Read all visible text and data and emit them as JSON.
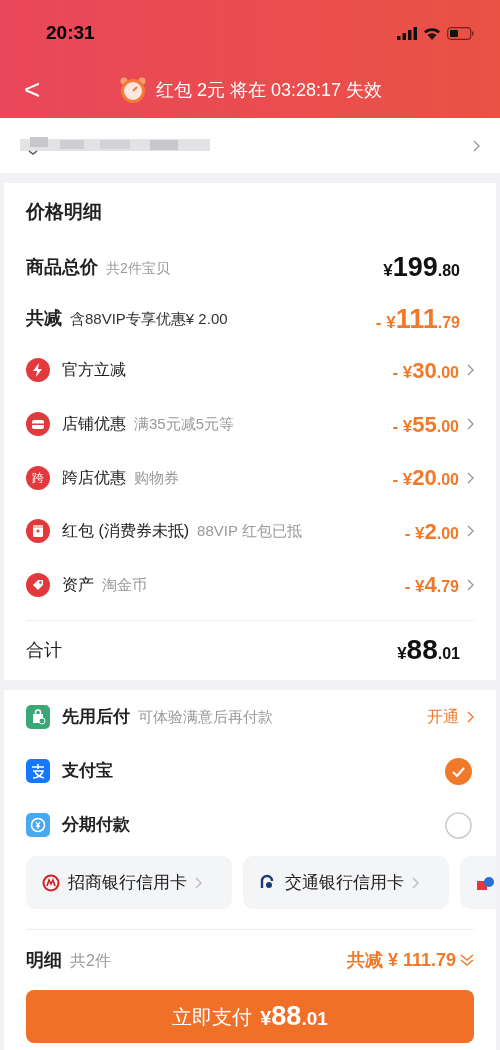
{
  "status_bar": {
    "time": "20:31"
  },
  "header": {
    "back": "<",
    "parts": [
      "红包",
      "2元",
      "将在",
      "03:28:17",
      "失效"
    ]
  },
  "price_detail": {
    "title": "价格明细",
    "total": {
      "label": "商品总价",
      "note": "共2件宝贝",
      "amount": {
        "prefix": "¥",
        "main": "199",
        "fraction": ".80"
      }
    },
    "reduction": {
      "label": "共减",
      "note": "含88VIP专享优惠¥ 2.00",
      "amount": {
        "prefix": "- ¥",
        "main": "111",
        "fraction": ".79"
      }
    },
    "discounts": [
      {
        "label": "官方立减",
        "amount": {
          "prefix": "- ¥",
          "main": "30",
          "fraction": ".00"
        }
      },
      {
        "label": "店铺优惠",
        "note": "满35元减5元等",
        "amount": {
          "prefix": "- ¥",
          "main": "55",
          "fraction": ".00"
        }
      },
      {
        "label": "跨店优惠",
        "note": "购物券",
        "icon_text": "跨",
        "amount": {
          "prefix": "- ¥",
          "main": "20",
          "fraction": ".00"
        }
      },
      {
        "label": "红包 (消费券未抵)",
        "note": "88VIP 红包已抵",
        "amount": {
          "prefix": "- ¥",
          "main": "2",
          "fraction": ".00"
        }
      },
      {
        "label": "资产",
        "note": "淘金币",
        "amount": {
          "prefix": "- ¥",
          "main": "4",
          "fraction": ".79"
        }
      }
    ],
    "sum": {
      "label": "合计",
      "amount": {
        "prefix": "¥",
        "main": "88",
        "fraction": ".01"
      }
    }
  },
  "pay_later": {
    "label": "先用后付",
    "note": "可体验满意后再付款",
    "action": "开通"
  },
  "payment_options": [
    {
      "label": "支付宝",
      "selected": true
    },
    {
      "label": "分期付款",
      "selected": false
    }
  ],
  "bank_cards": [
    {
      "label": "招商银行信用卡"
    },
    {
      "label": "交通银行信用卡"
    }
  ],
  "summary": {
    "label": "明细",
    "note": "共2件",
    "reduction": "共减 ¥ 111.79"
  },
  "pay_button": {
    "label": "立即支付",
    "amount": {
      "prefix": "¥",
      "main": "88",
      "fraction": ".01"
    }
  }
}
